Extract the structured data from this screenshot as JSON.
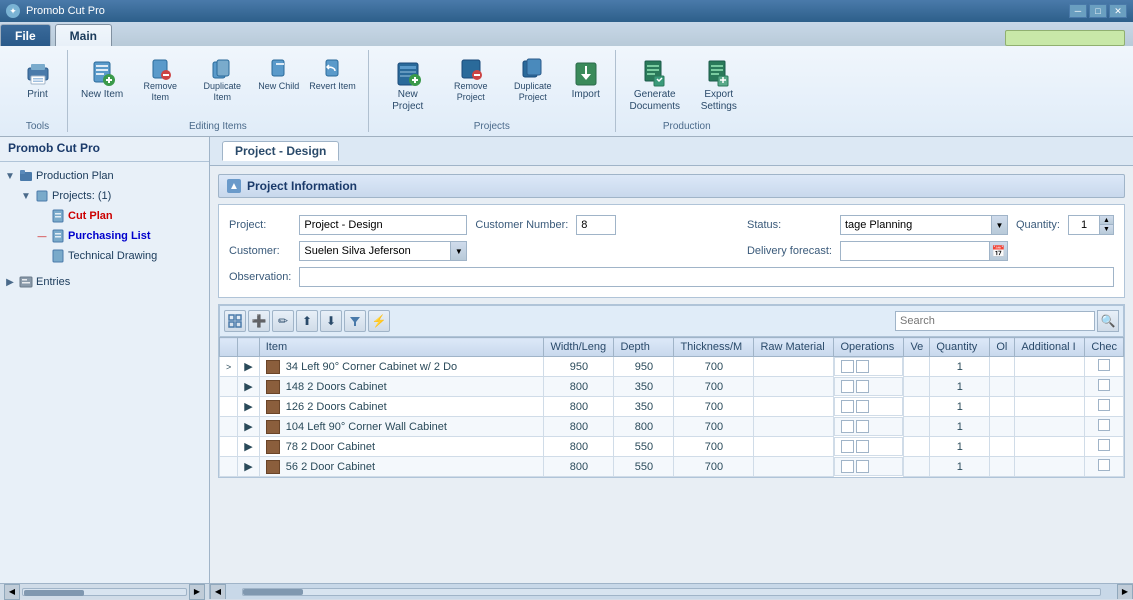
{
  "app": {
    "title": "Promob Cut Pro",
    "icon": "✦"
  },
  "titlebar": {
    "minimize": "─",
    "maximize": "□",
    "close": "✕"
  },
  "ribbon": {
    "tabs": [
      "File",
      "Main"
    ],
    "active_tab": "Main",
    "search_placeholder": "",
    "groups": [
      {
        "label": "Tools",
        "buttons": [
          {
            "label": "Print",
            "icon": "🖨",
            "key": "print"
          }
        ]
      },
      {
        "label": "Editing Items",
        "buttons": [
          {
            "label": "New Item",
            "icon": "📋",
            "key": "new-item"
          },
          {
            "label": "Remove Item",
            "icon": "📋",
            "key": "remove-item"
          },
          {
            "label": "Duplicate Item",
            "icon": "📋",
            "key": "duplicate-item"
          },
          {
            "label": "New Child",
            "icon": "📋",
            "key": "new-child"
          },
          {
            "label": "Revert Item",
            "icon": "📋",
            "key": "revert-item"
          }
        ]
      },
      {
        "label": "Projects",
        "buttons": [
          {
            "label": "New Project",
            "icon": "📄",
            "key": "new-project"
          },
          {
            "label": "Remove Project",
            "icon": "📄",
            "key": "remove-project"
          },
          {
            "label": "Duplicate Project",
            "icon": "📄",
            "key": "duplicate-project"
          },
          {
            "label": "Import",
            "icon": "📥",
            "key": "import"
          }
        ]
      },
      {
        "label": "Production",
        "buttons": [
          {
            "label": "Generate Documents",
            "icon": "📊",
            "key": "generate-docs"
          },
          {
            "label": "Export Settings",
            "icon": "📊",
            "key": "export-settings"
          }
        ]
      }
    ]
  },
  "sidebar": {
    "title": "Promob Cut Pro",
    "tree": [
      {
        "label": "Production Plan",
        "expanded": true,
        "icon": "📁",
        "children": [
          {
            "label": "Projects: (1)",
            "icon": "📋",
            "expanded": true,
            "children": [
              {
                "label": "Cut Plan",
                "icon": "📄",
                "style": "red"
              },
              {
                "label": "Purchasing List",
                "icon": "📄",
                "style": "blue"
              },
              {
                "label": "Technical Drawing",
                "icon": "📄",
                "style": "normal"
              }
            ]
          }
        ]
      },
      {
        "label": "Entries",
        "icon": "✉",
        "expanded": false,
        "children": []
      }
    ]
  },
  "content": {
    "tab": "Project - Design",
    "section_title": "Project Information",
    "form": {
      "project_label": "Project:",
      "project_value": "Project - Design",
      "customer_number_label": "Customer Number:",
      "customer_number_value": "8",
      "status_label": "Status:",
      "status_value": "tage Planning",
      "quantity_label": "Quantity:",
      "quantity_value": "1",
      "customer_label": "Customer:",
      "customer_value": "Suelen Silva Jeferson",
      "delivery_label": "Delivery forecast:",
      "delivery_value": "",
      "observation_label": "Observation:",
      "observation_value": ""
    },
    "grid": {
      "search_placeholder": "Search",
      "columns": [
        "",
        "",
        "Item",
        "Width/Leng",
        "Depth",
        "Thickness/M",
        "Raw Material",
        "Operations",
        "Ve",
        "Quantity",
        "Ol",
        "Additional I",
        "Chec"
      ],
      "rows": [
        {
          "expand": ">",
          "arrow": "▶",
          "id": "34",
          "name": "Left 90° Corner Cabinet w/ 2 Do",
          "width": "950",
          "depth": "950",
          "thickness": "700",
          "material": "",
          "ops": "",
          "ve": "",
          "qty": "1",
          "ol": "",
          "add": "",
          "check": false
        },
        {
          "expand": "",
          "arrow": "▶",
          "id": "148",
          "name": "2 Doors Cabinet",
          "width": "800",
          "depth": "350",
          "thickness": "700",
          "material": "",
          "ops": "",
          "ve": "",
          "qty": "1",
          "ol": "",
          "add": "",
          "check": false
        },
        {
          "expand": "",
          "arrow": "▶",
          "id": "126",
          "name": "2 Doors Cabinet",
          "width": "800",
          "depth": "350",
          "thickness": "700",
          "material": "",
          "ops": "",
          "ve": "",
          "qty": "1",
          "ol": "",
          "add": "",
          "check": false
        },
        {
          "expand": "",
          "arrow": "▶",
          "id": "104",
          "name": "Left 90° Corner Wall Cabinet",
          "width": "800",
          "depth": "800",
          "thickness": "700",
          "material": "",
          "ops": "",
          "ve": "",
          "qty": "1",
          "ol": "",
          "add": "",
          "check": false
        },
        {
          "expand": "",
          "arrow": "▶",
          "id": "78",
          "name": "2 Door Cabinet",
          "width": "800",
          "depth": "550",
          "thickness": "700",
          "material": "",
          "ops": "",
          "ve": "",
          "qty": "1",
          "ol": "",
          "add": "",
          "check": false
        },
        {
          "expand": "",
          "arrow": "▶",
          "id": "56",
          "name": "2 Door Cabinet",
          "width": "800",
          "depth": "550",
          "thickness": "700",
          "material": "",
          "ops": "",
          "ve": "",
          "qty": "1",
          "ol": "",
          "add": "",
          "check": false
        }
      ]
    }
  }
}
